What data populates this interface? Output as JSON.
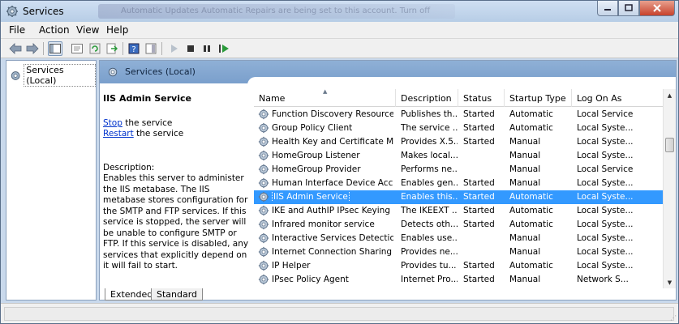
{
  "window": {
    "title": "Services",
    "ghost_text": "Automatic Updates   Automatic Repairs are being set to this account.   Turn off"
  },
  "menu": [
    {
      "label": "File"
    },
    {
      "label": "Action"
    },
    {
      "label": "View"
    },
    {
      "label": "Help"
    }
  ],
  "tree": {
    "item": "Services (Local)"
  },
  "panel": {
    "title": "Services (Local)"
  },
  "description": {
    "service_name": "IIS Admin Service",
    "stop_link": "Stop",
    "stop_suffix": " the service",
    "restart_link": "Restart",
    "restart_suffix": " the service",
    "heading": "Description:",
    "text": "Enables this server to administer the IIS metabase. The IIS metabase stores configuration for the SMTP and FTP services. If this service is stopped, the server will be unable to configure SMTP or FTP. If this service is disabled, any services that explicitly depend on it will fail to start."
  },
  "columns": {
    "name": "Name",
    "description": "Description",
    "status": "Status",
    "startup": "Startup Type",
    "logon": "Log On As"
  },
  "rows": [
    {
      "name": "Function Discovery Resource ...",
      "description": "Publishes th...",
      "status": "Started",
      "startup": "Automatic",
      "logon": "Local Service"
    },
    {
      "name": "Group Policy Client",
      "description": "The service ...",
      "status": "Started",
      "startup": "Automatic",
      "logon": "Local Syste..."
    },
    {
      "name": "Health Key and Certificate Ma...",
      "description": "Provides X.5...",
      "status": "Started",
      "startup": "Manual",
      "logon": "Local Syste..."
    },
    {
      "name": "HomeGroup Listener",
      "description": "Makes local...",
      "status": "",
      "startup": "Manual",
      "logon": "Local Syste..."
    },
    {
      "name": "HomeGroup Provider",
      "description": "Performs ne...",
      "status": "",
      "startup": "Manual",
      "logon": "Local Service"
    },
    {
      "name": "Human Interface Device Access",
      "description": "Enables gen...",
      "status": "Started",
      "startup": "Manual",
      "logon": "Local Syste..."
    },
    {
      "name": "IIS Admin Service",
      "description": "Enables this...",
      "status": "Started",
      "startup": "Automatic",
      "logon": "Local Syste..."
    },
    {
      "name": "IKE and AuthIP IPsec Keying M...",
      "description": "The IKEEXT ...",
      "status": "Started",
      "startup": "Automatic",
      "logon": "Local Syste..."
    },
    {
      "name": "Infrared monitor service",
      "description": "Detects oth...",
      "status": "Started",
      "startup": "Automatic",
      "logon": "Local Syste..."
    },
    {
      "name": "Interactive Services Detection",
      "description": "Enables use...",
      "status": "",
      "startup": "Manual",
      "logon": "Local Syste..."
    },
    {
      "name": "Internet Connection Sharing (I...",
      "description": "Provides ne...",
      "status": "",
      "startup": "Manual",
      "logon": "Local Syste..."
    },
    {
      "name": "IP Helper",
      "description": "Provides tu...",
      "status": "Started",
      "startup": "Automatic",
      "logon": "Local Syste..."
    },
    {
      "name": "IPsec Policy Agent",
      "description": "Internet Pro...",
      "status": "Started",
      "startup": "Manual",
      "logon": "Network S..."
    }
  ],
  "selected_row": "IIS Admin Service",
  "tabs": [
    {
      "label": "Extended"
    },
    {
      "label": "Standard"
    }
  ],
  "colors": {
    "selection": "#3399ff",
    "header_band": "#8fb0d6",
    "link": "#0033cc"
  }
}
